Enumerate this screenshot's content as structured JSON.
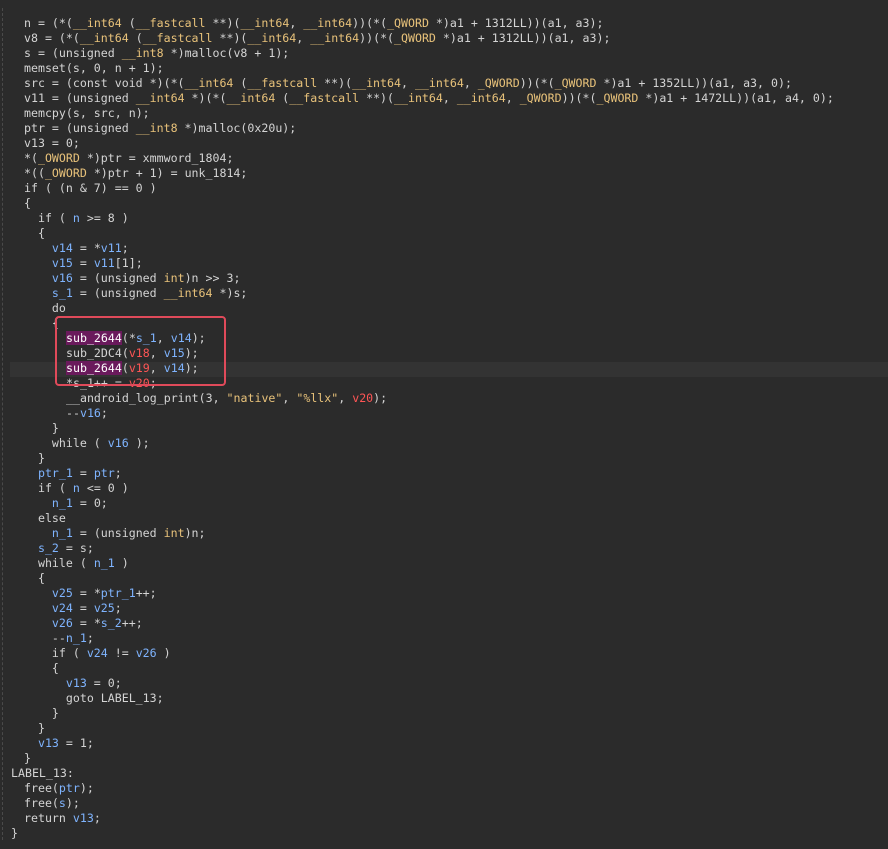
{
  "code": {
    "l01": {
      "a": "n = (*(",
      "b": "__int64",
      "c": " (",
      "d": "__fastcall",
      "e": " **)(",
      "f": "__int64",
      "g": ", ",
      "h": "__int64",
      "i": "))(*(",
      "j": "_QWORD",
      "k": " *)a1 + 1312LL))(a1, a3);"
    },
    "l02": {
      "a": "v8 = (*(",
      "b": "__int64",
      "c": " (",
      "d": "__fastcall",
      "e": " **)(",
      "f": "__int64",
      "g": ", ",
      "h": "__int64",
      "i": "))(*(",
      "j": "_QWORD",
      "k": " *)a1 + 1312LL))(a1, a3);"
    },
    "l03": {
      "a": "s = (unsigned ",
      "b": "__int8",
      "c": " *)",
      "d": "malloc",
      "e": "(v8 + 1);"
    },
    "l04": {
      "a": "memset",
      "b": "(s, 0, n + 1);"
    },
    "l05": {
      "a": "src = (const void *)(*(",
      "b": "__int64",
      "c": " (",
      "d": "__fastcall",
      "e": " **)(",
      "f": "__int64",
      "g": ", ",
      "h": "__int64",
      "i": ", ",
      "j": "_QWORD",
      "k": "))(*(",
      "l": "_QWORD",
      "m": " *)a1 + 1352LL))(a1, a3, 0);"
    },
    "l06": {
      "a": "v11 = (unsigned ",
      "b": "__int64",
      "c": " *)(*(",
      "d": "__int64",
      "e": " (",
      "f": "__fastcall",
      "g": " **)(",
      "h": "__int64",
      "i": ", ",
      "j": "__int64",
      "k": ", ",
      "l": "_QWORD",
      "m": "))(*(",
      "n": "_QWORD",
      "o": " *)a1 + 1472LL))(a1, a4, 0);"
    },
    "l07": {
      "a": "memcpy",
      "b": "(s, src, n);"
    },
    "l08": {
      "a": "ptr = (unsigned ",
      "b": "__int8",
      "c": " *)",
      "d": "malloc",
      "e": "(0x20u);"
    },
    "l09": {
      "a": "v13 = 0;"
    },
    "l10": {
      "a": "*(",
      "b": "_OWORD",
      "c": " *)ptr = xmmword_1804;"
    },
    "l11": {
      "a": "*((",
      "b": "_OWORD",
      "c": " *)ptr + 1) = unk_1814;"
    },
    "l12": {
      "a": "if ( (n & 7) == 0 )"
    },
    "l13": {
      "a": "{"
    },
    "l14": {
      "a": "  if ( ",
      "b": "n",
      "c": " >= 8 )"
    },
    "l15": {
      "a": "  {"
    },
    "l16": {
      "a": "    v14",
      "b": " = *",
      "c": "v11",
      "d": ";"
    },
    "l17": {
      "a": "    v15",
      "b": " = ",
      "c": "v11",
      "d": "[1];"
    },
    "l18": {
      "a": "    v16",
      "b": " = (unsigned ",
      "c": "int",
      "d": ")n >> 3;"
    },
    "l19": {
      "a": "    s_1",
      "b": " = (unsigned ",
      "c": "__int64",
      "d": " *)s;"
    },
    "l20": {
      "a": "    do"
    },
    "l21": {
      "a": "    {"
    },
    "l22": {
      "a": "sub_2644",
      "b": "(*",
      "c": "s_1",
      "d": ", ",
      "e": "v14",
      "f": ");"
    },
    "l23": {
      "a": "sub_2DC4",
      "b": "(",
      "c": "v18",
      "d": ", ",
      "e": "v15",
      "f": ");"
    },
    "l24": {
      "a": "sub_2644",
      "b": "(",
      "c": "v19",
      "d": ", ",
      "e": "v14",
      "f": ");"
    },
    "l25": {
      "a": "*s_1++ = ",
      "b": "v20",
      "c": ";"
    },
    "l26": {
      "a": "__android_log_print",
      "b": "(3, ",
      "c": "\"native\"",
      "d": ", ",
      "e": "\"%llx\"",
      "f": ", ",
      "g": "v20",
      "h": ");"
    },
    "l27": {
      "a": "--",
      "b": "v16",
      "c": ";"
    },
    "l28": {
      "a": "    }"
    },
    "l29": {
      "a": "    while ( ",
      "b": "v16",
      "c": " );"
    },
    "l30": {
      "a": "  }"
    },
    "l31": {
      "a": "  ptr_1",
      "b": " = ",
      "c": "ptr",
      "d": ";"
    },
    "l32": {
      "a": "  if ( ",
      "b": "n",
      "c": " <= 0 )"
    },
    "l33": {
      "a": "    n_1",
      "b": " = 0;"
    },
    "l34": {
      "a": "  else"
    },
    "l35": {
      "a": "    n_1",
      "b": " = (unsigned ",
      "c": "int",
      "d": ")n;"
    },
    "l36": {
      "a": "  s_2",
      "b": " = ",
      "c": "s",
      "d": ";"
    },
    "l37": {
      "a": "  while ( ",
      "b": "n_1",
      "c": " )"
    },
    "l38": {
      "a": "  {"
    },
    "l39": {
      "a": "    v25",
      "b": " = *",
      "c": "ptr_1",
      "d": "++;"
    },
    "l40": {
      "a": "    v24",
      "b": " = ",
      "c": "v25",
      "d": ";"
    },
    "l41": {
      "a": "    v26",
      "b": " = *",
      "c": "s_2",
      "d": "++;"
    },
    "l42": {
      "a": "    --",
      "b": "n_1",
      "c": ";"
    },
    "l43": {
      "a": "    if ( ",
      "b": "v24",
      "c": " != ",
      "d": "v26",
      "e": " )"
    },
    "l44": {
      "a": "    {"
    },
    "l45": {
      "a": "      v13",
      "b": " = 0;"
    },
    "l46": {
      "a": "      goto LABEL_13;"
    },
    "l47": {
      "a": "    }"
    },
    "l48": {
      "a": "  }"
    },
    "l49": {
      "a": "  v13",
      "b": " = 1;"
    },
    "l50": {
      "a": "}"
    },
    "l51": {
      "a": "LABEL_13:"
    },
    "l52": {
      "a": "free",
      "b": "(",
      "c": "ptr",
      "d": ");"
    },
    "l53": {
      "a": "free",
      "b": "(",
      "c": "s",
      "d": ");"
    },
    "l54": {
      "a": "return ",
      "b": "v13",
      "c": ";"
    },
    "l55": {
      "a": "}"
    }
  }
}
